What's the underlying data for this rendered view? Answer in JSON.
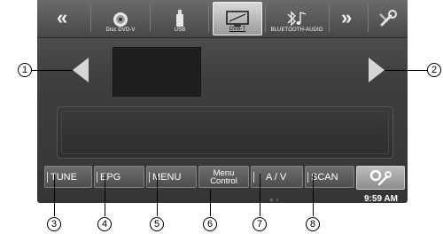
{
  "top_bar": {
    "rewind_glyph": "«",
    "forward_glyph": "»",
    "sources": [
      {
        "label": "Disc DVD-V",
        "icon": "disc-icon"
      },
      {
        "label": "USB",
        "icon": "usb-icon"
      },
      {
        "label": "DVB-T",
        "icon": "tv-icon",
        "selected": true
      },
      {
        "label": "BLUETOOTH-AUDIO",
        "icon": "bluetooth-audio-icon"
      }
    ],
    "settings_icon": "setup-wrench-icon"
  },
  "main": {
    "prev_arrow_icon": "triangle-left-icon",
    "next_arrow_icon": "triangle-right-icon"
  },
  "bottom_bar": {
    "buttons": [
      {
        "label": "TUNE"
      },
      {
        "label": "EPG"
      },
      {
        "label": "MENU"
      },
      {
        "label_line1": "Menu",
        "label_line2": "Control"
      },
      {
        "label": "A / V"
      },
      {
        "label": "SCAN"
      }
    ],
    "clock": "9:59 AM"
  },
  "callouts": [
    "1",
    "2",
    "3",
    "4",
    "5",
    "6",
    "7",
    "8"
  ]
}
